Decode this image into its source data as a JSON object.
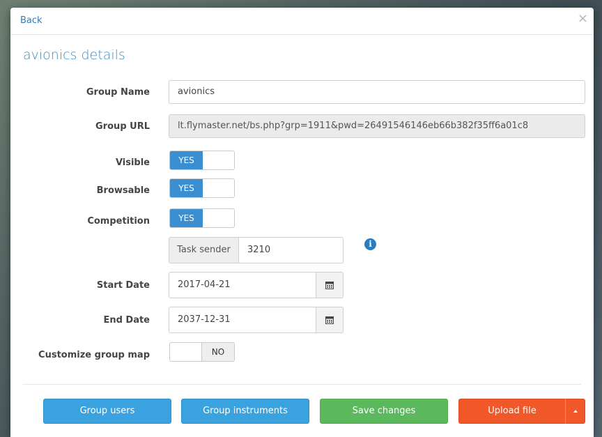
{
  "header": {
    "back_label": "Back",
    "close_label": "×"
  },
  "title": "avionics details",
  "form": {
    "group_name": {
      "label": "Group Name",
      "value": "avionics"
    },
    "group_url": {
      "label": "Group URL",
      "value": "lt.flymaster.net/bs.php?grp=1911&pwd=26491546146eb66b382f35ff6a01c8"
    },
    "visible": {
      "label": "Visible",
      "state": "YES"
    },
    "browsable": {
      "label": "Browsable",
      "state": "YES"
    },
    "competition": {
      "label": "Competition",
      "state": "YES"
    },
    "task_sender": {
      "addon": "Task sender",
      "value": "3210",
      "info_icon": "info-circle"
    },
    "start_date": {
      "label": "Start Date",
      "value": "2017-04-21",
      "icon": "calendar"
    },
    "end_date": {
      "label": "End Date",
      "value": "2037-12-31",
      "icon": "calendar"
    },
    "customize_map": {
      "label": "Customize group map",
      "state": "NO"
    }
  },
  "footer": {
    "group_users": "Group users",
    "group_instruments": "Group instruments",
    "save_changes": "Save changes",
    "upload_file": "Upload file"
  },
  "colors": {
    "accent": "#3aa3df",
    "toggle_on": "#3b8fd0",
    "success": "#5cb85c",
    "danger": "#f0582a",
    "title": "#3f8cc0"
  }
}
